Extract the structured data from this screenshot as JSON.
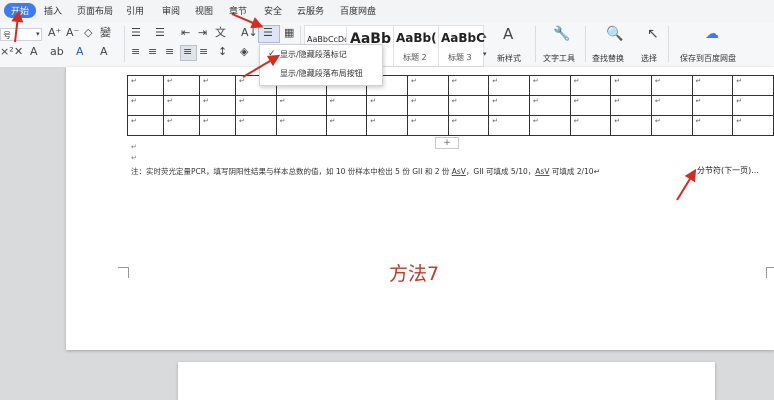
{
  "menu": [
    "开始",
    "插入",
    "页面布局",
    "引用",
    "审阅",
    "视图",
    "章节",
    "安全",
    "云服务",
    "百度网盘"
  ],
  "ribbon": {
    "font_size_value": "号",
    "style_samples": [
      {
        "sample": "AaBbCcDd",
        "name": ""
      },
      {
        "sample": "AaBb",
        "name": ""
      },
      {
        "sample": "AaBb(",
        "name": "标题 2"
      },
      {
        "sample": "AaBbC",
        "name": "标题 3"
      }
    ],
    "new_style_label": "新样式",
    "text_tools_label": "文字工具",
    "find_replace_label": "查找替换",
    "select_label": "选择",
    "save_baidu_label": "保存到百度网盘"
  },
  "dropdown": {
    "items": [
      "显示/隐藏段落标记",
      "显示/隐藏段落布局按钮"
    ]
  },
  "document": {
    "para_mark": "↵",
    "add_row_label": "+",
    "note": {
      "part1": "注：实时荧光定量PCR，填写阴阳性结果与样本总数的值，如 10 份样本中检出 5 份 GII 和 2 份 ",
      "asv1": "AsV",
      "part2": "，GII 可填成 5/10，",
      "asv2": "AsV",
      "part3": " 可填成 2/10",
      "end": "↵"
    },
    "section_break": "分节符(下一页)...",
    "method_label": "方法7"
  },
  "colors": {
    "accent": "#3d7cf0",
    "annotation_red": "#d62b1f",
    "method_red": "#c0392b"
  }
}
